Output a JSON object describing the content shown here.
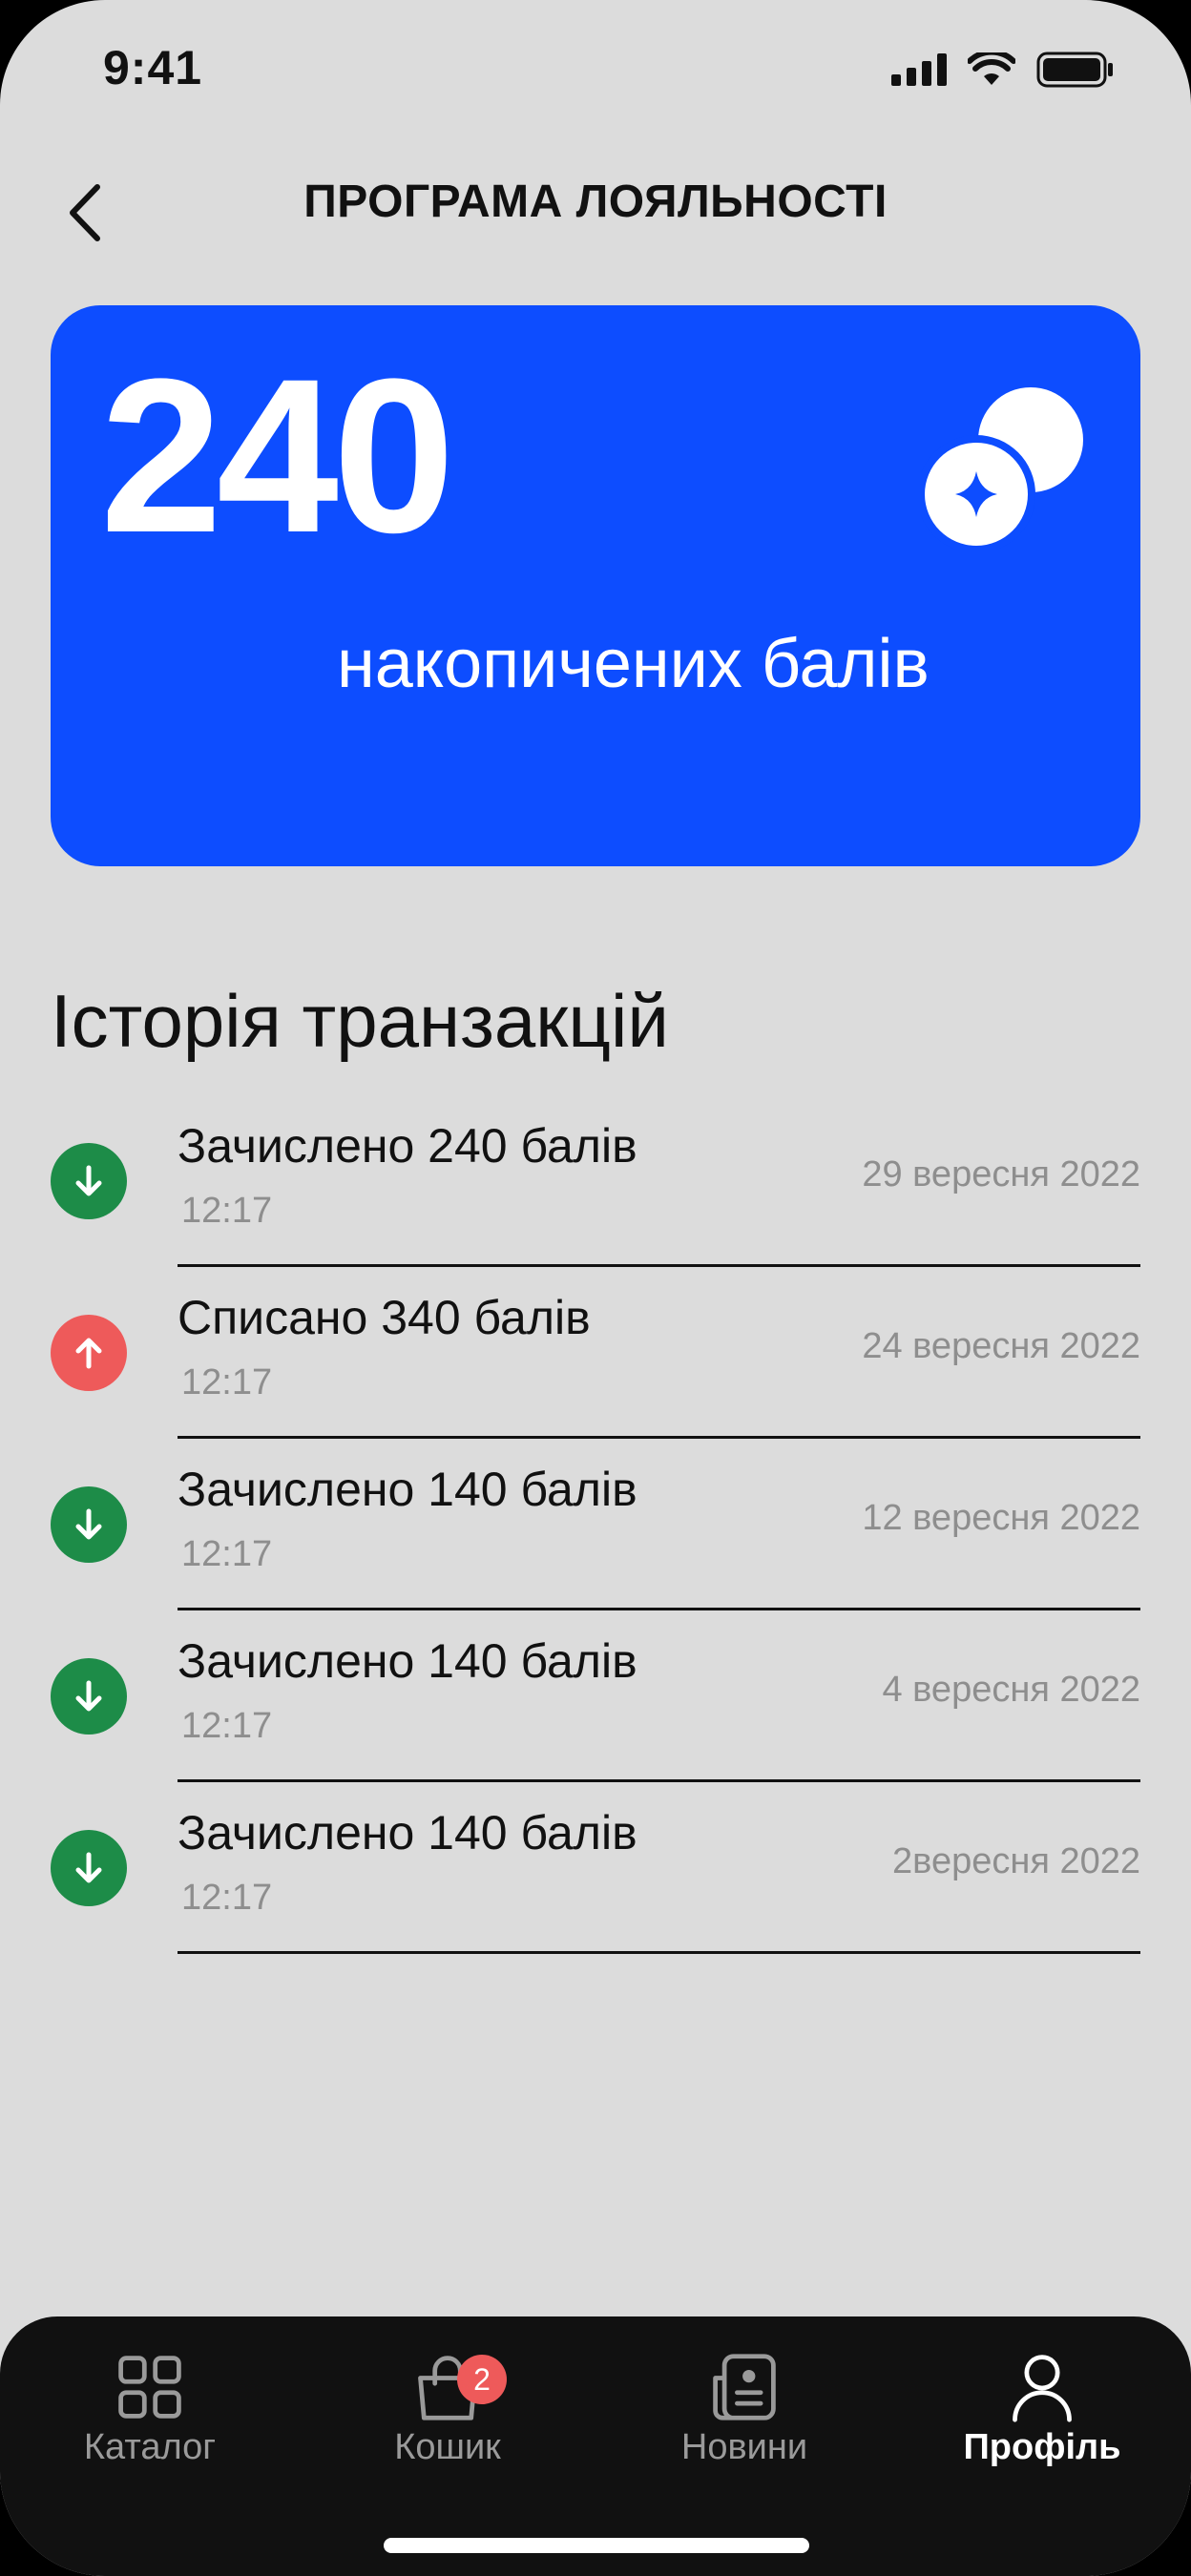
{
  "status_bar": {
    "time": "9:41"
  },
  "header": {
    "title": "ПРОГРАМА ЛОЯЛЬНОСТІ"
  },
  "points_card": {
    "value": "240",
    "label": "накопичених балів"
  },
  "history": {
    "title": "Історія транзакцій",
    "items": [
      {
        "text": "Зачислено 240 балів",
        "time": "12:17",
        "date": "29 вересня 2022",
        "type": "in"
      },
      {
        "text": "Списано 340 балів",
        "time": "12:17",
        "date": "24 вересня 2022",
        "type": "out"
      },
      {
        "text": "Зачислено 140 балів",
        "time": "12:17",
        "date": "12 вересня 2022",
        "type": "in"
      },
      {
        "text": "Зачислено 140 балів",
        "time": "12:17",
        "date": "4 вересня 2022",
        "type": "in"
      },
      {
        "text": "Зачислено 140 балів",
        "time": "12:17",
        "date": "2вересня 2022",
        "type": "in"
      }
    ]
  },
  "tabbar": {
    "tabs": [
      {
        "label": "Каталог",
        "icon": "grid-icon"
      },
      {
        "label": "Кошик",
        "icon": "bag-icon",
        "badge": "2"
      },
      {
        "label": "Новини",
        "icon": "news-icon"
      },
      {
        "label": "Профіль",
        "icon": "profile-icon",
        "active": true
      }
    ]
  },
  "colors": {
    "card_blue": "#0d4dff",
    "credit_green": "#1d8c48",
    "debit_red": "#ee5a5a",
    "background": "#dcdcdc",
    "tabbar": "#111111"
  }
}
